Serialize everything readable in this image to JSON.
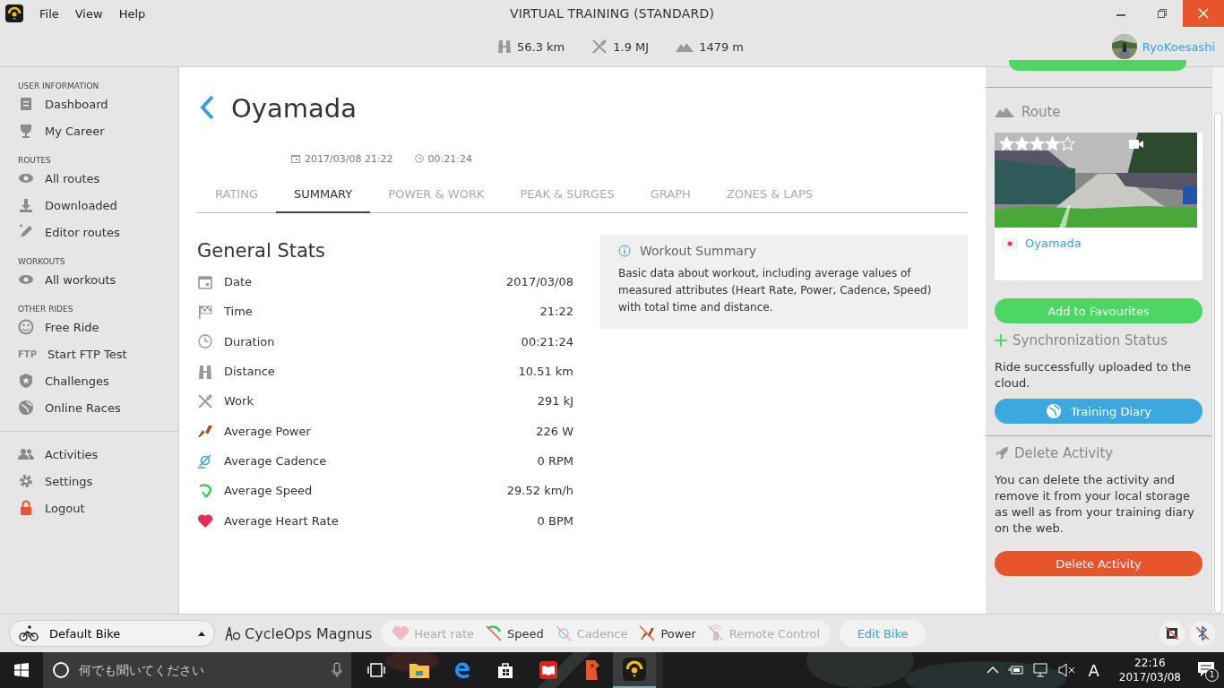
{
  "window": {
    "title": "VIRTUAL TRAINING (STANDARD)"
  },
  "menu": [
    "File",
    "View",
    "Help"
  ],
  "totals": [
    "56.3 km",
    "1.9 MJ",
    "1479 m"
  ],
  "user": {
    "name": "RyoKoesashi"
  },
  "sidebar": [
    {
      "heading": "USER INFORMATION",
      "items": [
        "Dashboard",
        "My Career"
      ]
    },
    {
      "heading": "ROUTES",
      "items": [
        "All routes",
        "Downloaded",
        "Editor routes"
      ]
    },
    {
      "heading": "WORKOUTS",
      "items": [
        "All workouts"
      ]
    },
    {
      "heading": "OTHER RIDES",
      "items": [
        "Free Ride",
        "Start FTP Test",
        "Challenges",
        "Online Races"
      ]
    },
    {
      "items": [
        "Activities",
        "Settings",
        "Logout"
      ]
    }
  ],
  "ftp_label": "FTP",
  "activity": {
    "title": "Oyamada",
    "date": "2017/03/08 21:22",
    "duration": "00:21:24"
  },
  "tabs": [
    {
      "label": "RATING",
      "selected": false
    },
    {
      "label": "SUMMARY",
      "selected": true
    },
    {
      "label": "POWER & WORK",
      "selected": false
    },
    {
      "label": "PEAK & SURGES",
      "selected": false
    },
    {
      "label": "GRAPH",
      "selected": false
    },
    {
      "label": "ZONES & LAPS",
      "selected": false
    }
  ],
  "general_stats": {
    "title": "General Stats",
    "rows": [
      {
        "label": "Date",
        "value": "2017/03/08"
      },
      {
        "label": "Time",
        "value": "21:22"
      },
      {
        "label": "Duration",
        "value": "00:21:24"
      },
      {
        "label": "Distance",
        "value": "10.51 km"
      },
      {
        "label": "Work",
        "value": "291 kJ"
      },
      {
        "label": "Average Power",
        "value": "226 W"
      },
      {
        "label": "Average Cadence",
        "value": "0 RPM"
      },
      {
        "label": "Average Speed",
        "value": "29.52 km/h"
      },
      {
        "label": "Average Heart Rate",
        "value": "0 BPM"
      }
    ]
  },
  "info": {
    "title": "Workout Summary",
    "text": "Basic data about workout, including average values of measured attributes (Heart Rate, Power, Cadence, Speed) with total time and distance."
  },
  "route": {
    "heading": "Route",
    "stars": 4,
    "name": "Oyamada"
  },
  "favourite_button": "Add to Favourites",
  "sync": {
    "heading": "Synchronization Status",
    "text": "Ride successfully uploaded to the cloud.",
    "button": "Training Diary"
  },
  "delete": {
    "heading": "Delete Activity",
    "text": "You can delete the activity and remove it from your local storage as well as from your training diary on the web.",
    "button": "Delete Activity"
  },
  "bike": {
    "name": "Default Bike",
    "trainer": "CycleOps Magnus"
  },
  "sensors": [
    {
      "label": "Heart rate",
      "connected": false
    },
    {
      "label": "Speed",
      "connected": true
    },
    {
      "label": "Cadence",
      "connected": false
    },
    {
      "label": "Power",
      "connected": true
    },
    {
      "label": "Remote Control",
      "connected": false
    }
  ],
  "edit_bike": "Edit Bike",
  "taskbar": {
    "search_placeholder": "何でも聞いてください",
    "ime": "A",
    "time": "22:16",
    "date": "2017/03/08",
    "notifications": "1"
  }
}
